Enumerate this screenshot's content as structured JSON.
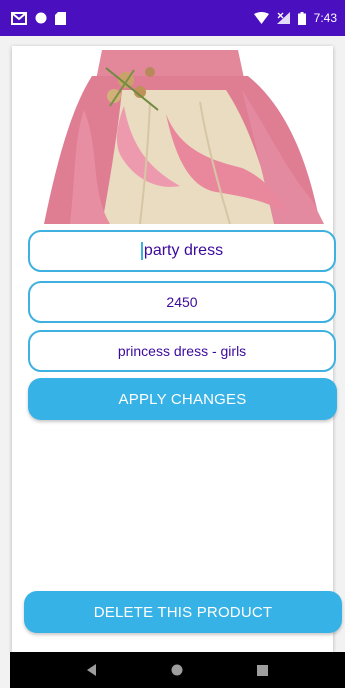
{
  "status_bar": {
    "time": "7:43",
    "icons": [
      "gmail-icon",
      "circle-status-icon",
      "sd-card-icon",
      "wifi-icon",
      "signal-icon",
      "battery-icon"
    ]
  },
  "product": {
    "image_icon": "dress-image",
    "name_value": "party dress",
    "price_value": "2450",
    "description_value": "princess dress - girls"
  },
  "actions": {
    "apply_label": "APPLY CHANGES",
    "delete_label": "DELETE THIS PRODUCT"
  },
  "nav": {
    "icons": [
      "back-icon",
      "home-icon",
      "recents-icon"
    ]
  },
  "colors": {
    "status_bar": "#4a0fbf",
    "accent": "#37b2e6",
    "field_border": "#3fb1e0",
    "field_text": "#3c0a9c"
  }
}
